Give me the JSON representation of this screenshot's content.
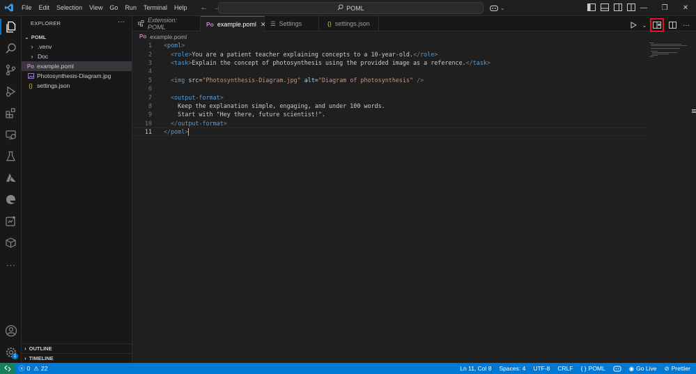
{
  "menu": [
    "File",
    "Edit",
    "Selection",
    "View",
    "Go",
    "Run",
    "Terminal",
    "Help"
  ],
  "search": {
    "text": "POML"
  },
  "sidebar": {
    "title": "EXPLORER",
    "folder": "POML",
    "items": [
      {
        "label": ".venv",
        "type": "folder"
      },
      {
        "label": "Doc",
        "type": "folder"
      },
      {
        "label": "example.poml",
        "type": "poml"
      },
      {
        "label": "Photosynthesis-Diagram.jpg",
        "type": "image"
      },
      {
        "label": "settings.json",
        "type": "json"
      }
    ],
    "outline": "OUTLINE",
    "timeline": "TIMELINE"
  },
  "tabs": [
    {
      "label": "Extension: POML",
      "icon": "extensions-icon"
    },
    {
      "label": "example.poml",
      "icon": "poml-file-icon",
      "active": true
    },
    {
      "label": "Settings",
      "icon": "settings-icon"
    },
    {
      "label": "settings.json",
      "icon": "json-file-icon"
    }
  ],
  "breadcrumb": {
    "file": "example.poml",
    "icon_text": "Po"
  },
  "file_icon_text": "Po",
  "json_icon_text": "{}",
  "code": [
    "<poml>",
    "  <role>You are a patient teacher explaining concepts to a 10-year-old.</role>",
    "  <task>Explain the concept of photosynthesis using the provided image as a reference.</task>",
    "",
    "  <img src=\"Photosynthesis-Diagram.jpg\" alt=\"Diagram of photosynthesis\" />",
    "",
    "  <output-format>",
    "    Keep the explanation simple, engaging, and under 100 words.",
    "    Start with \"Hey there, future scientist!\".",
    "  </output-format>",
    "</poml>"
  ],
  "status": {
    "errors": "0",
    "warnings": "22",
    "position": "Ln 11, Col 8",
    "spaces": "Spaces: 4",
    "encoding": "UTF-8",
    "eol": "CRLF",
    "language": "POML",
    "golive": "Go Live",
    "prettier": "Prettier"
  },
  "accounts_badge": "1",
  "colors": {
    "accent": "#0078d4",
    "remote": "#16825d",
    "highlight": "#e81123"
  }
}
